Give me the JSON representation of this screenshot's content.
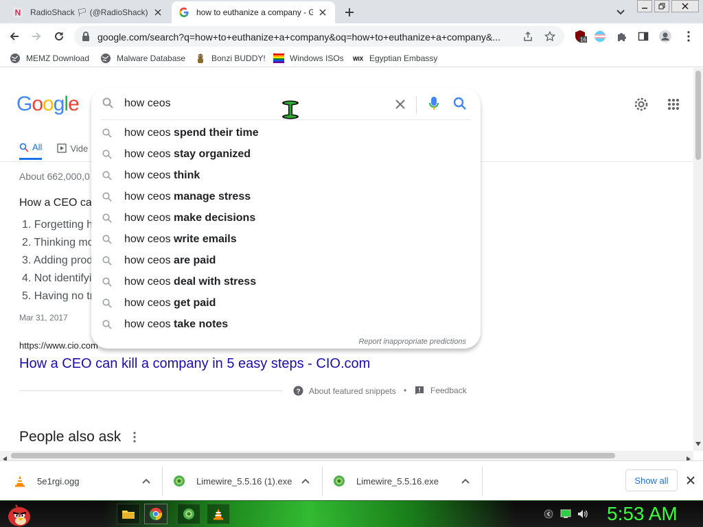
{
  "window": {
    "tabs": [
      {
        "title": "RadioShack 🏳 (@RadioShack)|nitte",
        "favicon": "n-icon",
        "active": false
      },
      {
        "title": "how to euthanize a company - Goo",
        "favicon": "google-icon",
        "active": true
      }
    ],
    "controls": [
      "minimize-icon",
      "restore-icon",
      "close-icon"
    ]
  },
  "toolbar": {
    "url": "google.com/search?q=how+to+euthanize+a+company&oq=how+to+euthanize+a+company&...",
    "extension_badge": "16"
  },
  "bookmarks": [
    {
      "label": "MEMZ Download",
      "icon": "globe-icon"
    },
    {
      "label": "Malware Database",
      "icon": "globe-icon"
    },
    {
      "label": "Bonzi BUDDY!",
      "icon": "bonzi-icon"
    },
    {
      "label": "Windows ISOs",
      "icon": "rainbow-flag-icon"
    },
    {
      "label": "Egyptian Embassy",
      "icon": "wix-icon"
    }
  ],
  "google": {
    "logo_text": "Google",
    "search_query": "how ceos",
    "tabs": [
      {
        "label": "All",
        "icon": "search-icon",
        "active": true
      },
      {
        "label": "Vide",
        "icon": "video-icon",
        "active": false
      }
    ],
    "stats": "About 662,000,0",
    "snippet_title": "How a CEO can",
    "snippet_items": [
      "1. Forgetting h",
      "2. Thinking mo",
      "3. Adding prod",
      "4. Not identifyi",
      "5. Having no tr"
    ],
    "snippet_date": "Mar 31, 2017",
    "source_url": "https://www.cio.com",
    "result_link": "How a CEO can kill a company in 5 easy steps - CIO.com",
    "about_snippets": "About featured snippets",
    "bullet": "•",
    "feedback": "Feedback",
    "people_also_ask": "People also ask"
  },
  "autocomplete": {
    "prefix": "how ceos",
    "suggestions": [
      "spend their time",
      "stay organized",
      "think",
      "manage stress",
      "make decisions",
      "write emails",
      "are paid",
      "deal with stress",
      "get paid",
      "take notes"
    ],
    "report_text": "Report inappropriate predictions"
  },
  "downloads": [
    {
      "name": "5e1rgi.ogg",
      "icon": "vlc-cone-icon"
    },
    {
      "name": "Limewire_5.5.16 (1).exe",
      "icon": "limewire-icon"
    },
    {
      "name": "Limewire_5.5.16.exe",
      "icon": "limewire-icon"
    }
  ],
  "downloads_show_all": "Show all",
  "taskbar": {
    "clock": "5:53 AM",
    "apps": [
      "folder-icon",
      "chrome-icon",
      "limewire-icon",
      "vlc-cone-icon"
    ]
  },
  "colors": {
    "google_blue": "#4285f4",
    "google_red": "#ea4335",
    "google_yellow": "#fbbc05",
    "google_green": "#34a853",
    "link": "#1a0dab",
    "clock_green": "#3cff3c"
  }
}
